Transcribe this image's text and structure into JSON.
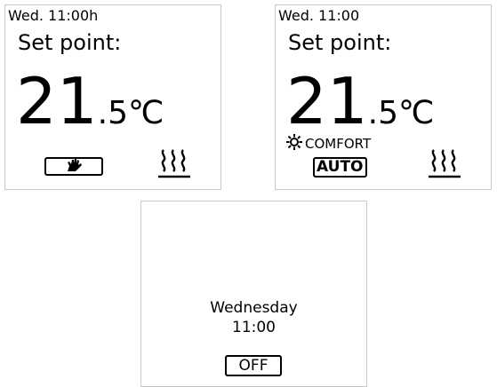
{
  "panel_manual": {
    "time": "Wed. 11:00h",
    "set_point_label": "Set point:",
    "temp_integer": "21",
    "temp_decimal": ".5℃",
    "mode_icon": "hand-icon",
    "status_icon": "heating-icon"
  },
  "panel_auto": {
    "time": "Wed. 11:00",
    "set_point_label": "Set point:",
    "temp_integer": "21",
    "temp_decimal": ".5℃",
    "comfort_label": "COMFORT",
    "comfort_icon": "sun-icon",
    "mode_label": "AUTO",
    "status_icon": "heating-icon"
  },
  "panel_off": {
    "day": "Wednesday",
    "time": "11:00",
    "mode_label": "OFF"
  }
}
